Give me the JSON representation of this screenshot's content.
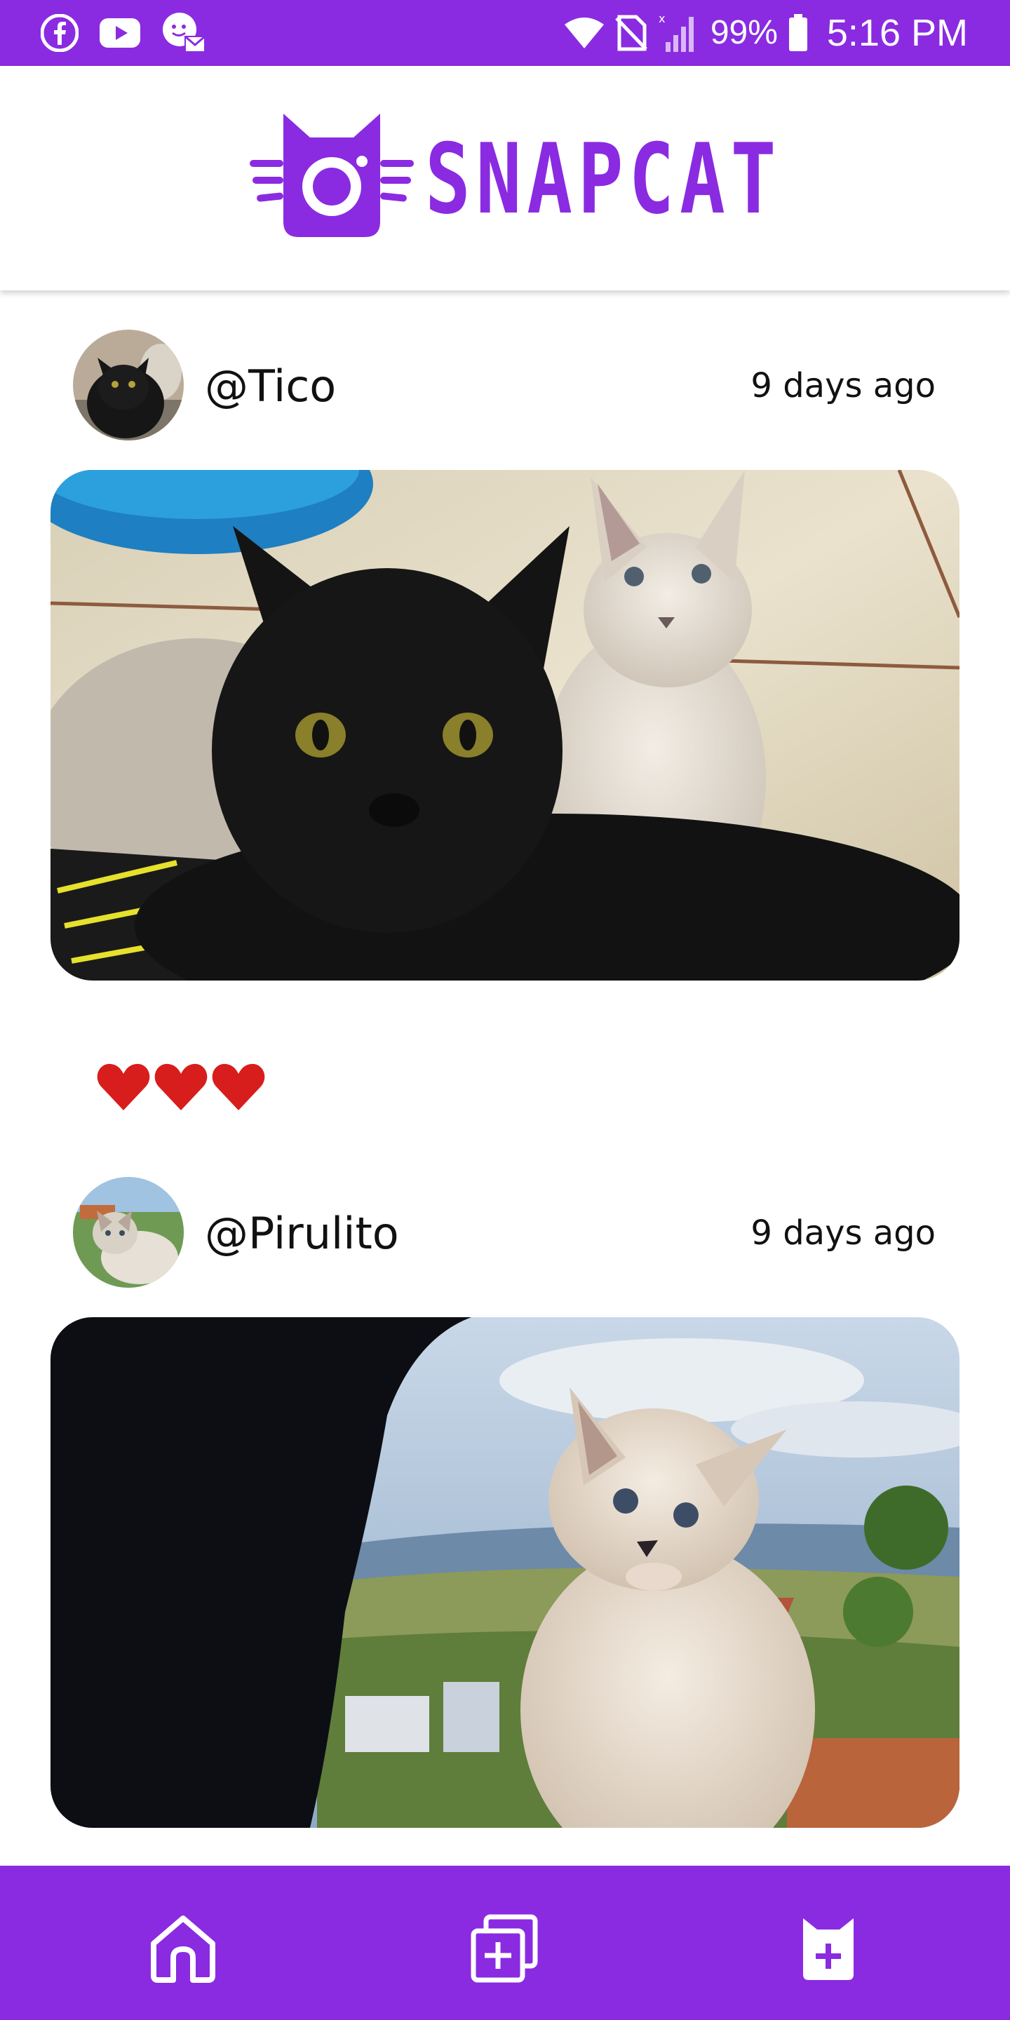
{
  "status_bar": {
    "left_icons": [
      "facebook-icon",
      "youtube-icon",
      "messenger-notification-icon"
    ],
    "right_icons": [
      "wifi-icon",
      "no-sim-icon",
      "signal-icon",
      "battery-icon"
    ],
    "battery_percent": "99%",
    "time": "5:16 PM"
  },
  "header": {
    "logo_text": "SNAPCAT",
    "logo_icon": "cat-camera-logo-icon"
  },
  "posts": [
    {
      "username": "@Tico",
      "time_ago": "9 days ago",
      "reactions": [
        "❤️",
        "❤️",
        "❤️"
      ]
    },
    {
      "username": "@Pirulito",
      "time_ago": "9 days ago"
    }
  ],
  "bottom_nav": {
    "items": [
      "home-icon",
      "new-post-icon",
      "cat-profile-icon"
    ]
  },
  "colors": {
    "brand": "#8a2be2",
    "heart": "#d81d1d"
  }
}
